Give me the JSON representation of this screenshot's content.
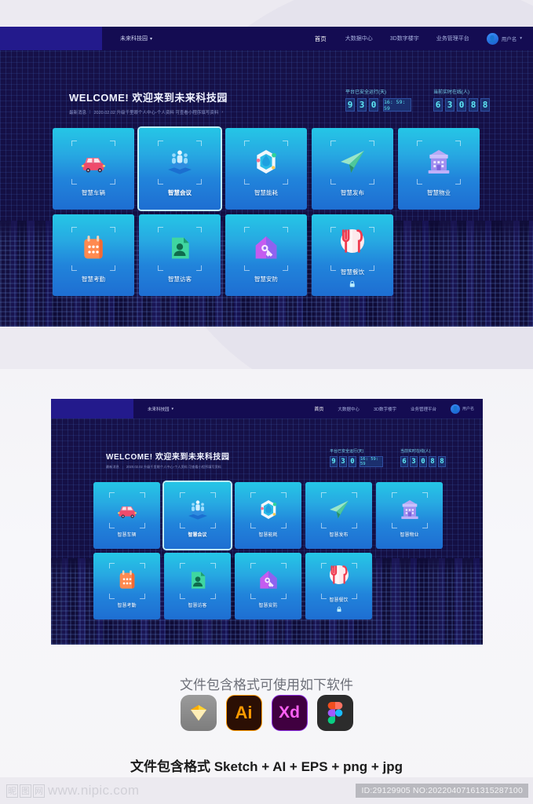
{
  "dashboard": {
    "brand": "未来科技园",
    "brand_caret": "▾",
    "nav": [
      {
        "label": "首页",
        "active": true
      },
      {
        "label": "大数据中心",
        "active": false
      },
      {
        "label": "3D数字楼宇",
        "active": false
      },
      {
        "label": "业务管理平台",
        "active": false
      }
    ],
    "user": {
      "name": "用户名",
      "caret": "▾"
    },
    "welcome": {
      "title": "WELCOME! 欢迎来到未来科技园",
      "news_label": "最新消息",
      "news_text": "2020.02.02 升级千里眼个人中心-个人资料 可查看小程序填写资料",
      "news_arrow": "›"
    },
    "counters": [
      {
        "label": "平台已安全运行(天)",
        "digits": [
          "9",
          "3",
          "0"
        ],
        "clock": "16: 59: 59"
      },
      {
        "label": "当前实时在线(人)",
        "digits": [
          "6",
          "3",
          "0",
          "8",
          "8"
        ],
        "clock": ""
      }
    ],
    "cards": [
      {
        "label": "智慧车辆",
        "icon": "car-icon",
        "selected": false,
        "locked": false
      },
      {
        "label": "智慧会议",
        "icon": "meeting-icon",
        "selected": true,
        "locked": false
      },
      {
        "label": "智慧能耗",
        "icon": "energy-icon",
        "selected": false,
        "locked": false
      },
      {
        "label": "智慧发布",
        "icon": "paperplane-icon",
        "selected": false,
        "locked": false
      },
      {
        "label": "智慧物业",
        "icon": "building-icon",
        "selected": false,
        "locked": false
      },
      {
        "label": "智慧考勤",
        "icon": "calendar-icon",
        "selected": false,
        "locked": false
      },
      {
        "label": "智慧访客",
        "icon": "visitor-badge-icon",
        "selected": false,
        "locked": false
      },
      {
        "label": "智慧安防",
        "icon": "house-key-icon",
        "selected": false,
        "locked": false
      },
      {
        "label": "智慧餐饮",
        "icon": "cutlery-icon",
        "selected": false,
        "locked": true,
        "lock_glyph": "🔒"
      }
    ]
  },
  "software": {
    "title": "文件包含格式可使用如下软件",
    "apps": [
      {
        "name": "Sketch",
        "label": ""
      },
      {
        "name": "Adobe Illustrator",
        "label": "Ai"
      },
      {
        "name": "Adobe XD",
        "label": "Xd"
      },
      {
        "name": "Figma",
        "label": ""
      }
    ],
    "formats_line": "文件包含格式 Sketch + AI + EPS + png + jpg"
  },
  "footer": {
    "watermark_chars": [
      "昵",
      "图",
      "网"
    ],
    "watermark_url": "www.nipic.com",
    "id_text": "ID:29129905 NO:20220407161315287100"
  },
  "colors": {
    "nav_bg": "#140c52",
    "hero_bg": "#151046",
    "card_top": "#25c6e6",
    "card_bottom": "#1e6ed2",
    "digit_text": "#5ee9f5",
    "accent": "#7ad8f0"
  }
}
